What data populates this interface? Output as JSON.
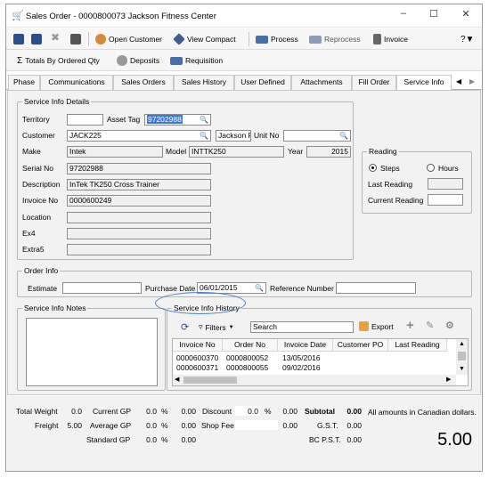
{
  "window": {
    "title": "Sales Order - 0000800073 Jackson Fitness Center"
  },
  "toolbar1": {
    "open_customer": "Open Customer",
    "view_compact": "View Compact",
    "process": "Process",
    "reprocess": "Reprocess",
    "invoice": "Invoice"
  },
  "toolbar2": {
    "totals": "Totals By Ordered Qty",
    "deposits": "Deposits",
    "requisition": "Requisition"
  },
  "tabs": [
    {
      "label": "Phase"
    },
    {
      "label": "Communications"
    },
    {
      "label": "Sales Orders"
    },
    {
      "label": "Sales History"
    },
    {
      "label": "User Defined"
    },
    {
      "label": "Attachments"
    },
    {
      "label": "Fill Order"
    },
    {
      "label": "Service Info"
    }
  ],
  "service_info_details": {
    "legend": "Service Info Details",
    "territory_label": "Territory",
    "territory_value": "",
    "asset_tag_label": "Asset Tag",
    "asset_tag_value": "97202988",
    "customer_label": "Customer",
    "customer_value": "JACK225",
    "customer_name": "Jackson Fi",
    "unit_no_label": "Unit No",
    "unit_no_value": "",
    "make_label": "Make",
    "make_value": "Intek",
    "model_label": "Model",
    "model_value": "INTTK250",
    "year_label": "Year",
    "year_value": "2015",
    "serial_label": "Serial No",
    "serial_value": "97202988",
    "description_label": "Description",
    "description_value": "InTek TK250 Cross Trainer",
    "invoice_label": "Invoice No",
    "invoice_value": "0000600249",
    "location_label": "Location",
    "ex4_label": "Ex4",
    "extra5_label": "Extra5"
  },
  "reading": {
    "legend": "Reading",
    "steps": "Steps",
    "hours": "Hours",
    "last_reading": "Last Reading",
    "current_reading": "Current Reading"
  },
  "order_info": {
    "legend": "Order Info",
    "estimate_label": "Estimate",
    "purchase_date_label": "Purchase Date",
    "purchase_date_value": "06/01/2015",
    "reference_label": "Reference Number"
  },
  "notes": {
    "legend": "Service Info Notes"
  },
  "history": {
    "legend": "Service Info History",
    "filters": "Filters",
    "search_placeholder": "Search",
    "export": "Export",
    "columns": [
      "Invoice No",
      "Order No",
      "Invoice Date",
      "Customer PO",
      "Last Reading"
    ],
    "rows": [
      [
        "0000600370",
        "0000800052",
        "13/05/2016",
        "",
        ""
      ],
      [
        "0000600371",
        "0000800055",
        "09/02/2016",
        "",
        ""
      ]
    ]
  },
  "footer": {
    "total_weight_label": "Total Weight",
    "total_weight": "0.0",
    "freight_label": "Freight",
    "freight": "5.00",
    "current_gp_label": "Current GP",
    "current_gp": "0.0",
    "average_gp_label": "Average GP",
    "average_gp": "0.0",
    "standard_gp_label": "Standard GP",
    "standard_gp": "0.0",
    "pct": "%",
    "gp_amt1": "0.00",
    "gp_amt2": "0.00",
    "gp_amt3": "0.00",
    "discount_label": "Discount",
    "discount_pct": "0.0",
    "discount_amt": "0.00",
    "shop_fee_label": "Shop Fee",
    "shop_fee_amt": "0.00",
    "subtotal_label": "Subtotal",
    "subtotal": "0.00",
    "gst_label": "G.S.T.",
    "gst": "0.00",
    "pst_label": "BC P.S.T.",
    "pst": "0.00",
    "currency_note": "All amounts in Canadian dollars.",
    "grand_total": "5.00"
  }
}
